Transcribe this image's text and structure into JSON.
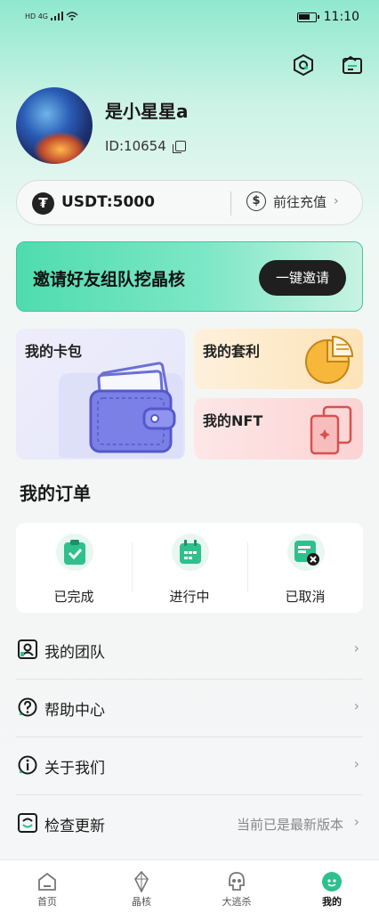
{
  "status_bar": {
    "network": "HD 4G",
    "time": "11:10"
  },
  "header_icons": [
    "settings-hex-icon",
    "message-box-icon"
  ],
  "profile": {
    "name": "是小星星a",
    "id_label": "ID:10654"
  },
  "balance": {
    "label": "USDT:5000",
    "recharge_label": "前往充值"
  },
  "invite": {
    "text": "邀请好友组队挖晶核",
    "button": "一键邀请"
  },
  "cards": {
    "wallet": "我的卡包",
    "arbitrage": "我的套利",
    "nft": "我的NFT"
  },
  "orders": {
    "title": "我的订单",
    "items": [
      {
        "label": "已完成",
        "icon": "clipboard-check-icon"
      },
      {
        "label": "进行中",
        "icon": "calendar-icon"
      },
      {
        "label": "已取消",
        "icon": "cancel-doc-icon"
      }
    ]
  },
  "menu": [
    {
      "label": "我的团队",
      "icon": "team-icon"
    },
    {
      "label": "帮助中心",
      "icon": "help-icon"
    },
    {
      "label": "关于我们",
      "icon": "info-icon"
    },
    {
      "label": "检查更新",
      "icon": "update-icon",
      "note": "当前已是最新版本"
    }
  ],
  "nav": [
    {
      "label": "首页",
      "icon": "home-icon"
    },
    {
      "label": "晶核",
      "icon": "crystal-icon"
    },
    {
      "label": "大逃杀",
      "icon": "skull-icon"
    },
    {
      "label": "我的",
      "icon": "profile-icon",
      "active": true
    }
  ],
  "colors": {
    "accent": "#2ec08d",
    "banner_dark": "#1f1f1f"
  }
}
